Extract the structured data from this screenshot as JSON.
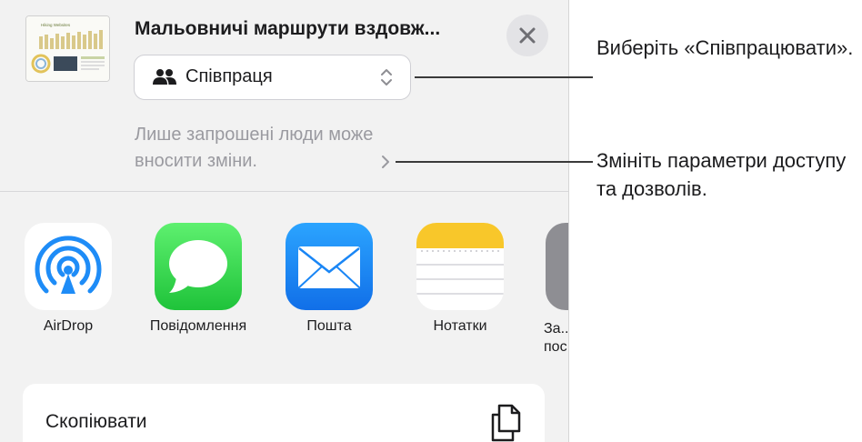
{
  "share_sheet": {
    "document_title": "Мальовничі маршрути вздовж...",
    "thumbnail_title": "Hiking Websites",
    "collaboration_option": "Співпраця",
    "access_description": "Лише запрошені люди може вносити зміни.",
    "apps": [
      {
        "label": "AirDrop",
        "icon": "airdrop-icon"
      },
      {
        "label": "Повідомлення",
        "icon": "messages-icon"
      },
      {
        "label": "Пошта",
        "icon": "mail-icon"
      },
      {
        "label": "Нотатки",
        "icon": "notes-icon"
      },
      {
        "label": "За... пос...",
        "icon": "reminders-icon"
      }
    ],
    "copy_label": "Скопіювати"
  },
  "callouts": {
    "collaborate": "Виберіть «Співпрацювати».",
    "access": "Змініть параметри доступу та дозволів."
  },
  "colors": {
    "sheet_background": "#f2f2f2",
    "messages_green": "#28c840",
    "mail_blue": "#1a86f5",
    "airdrop_blue": "#1e8cf7",
    "notes_yellow": "#f8c72a"
  }
}
